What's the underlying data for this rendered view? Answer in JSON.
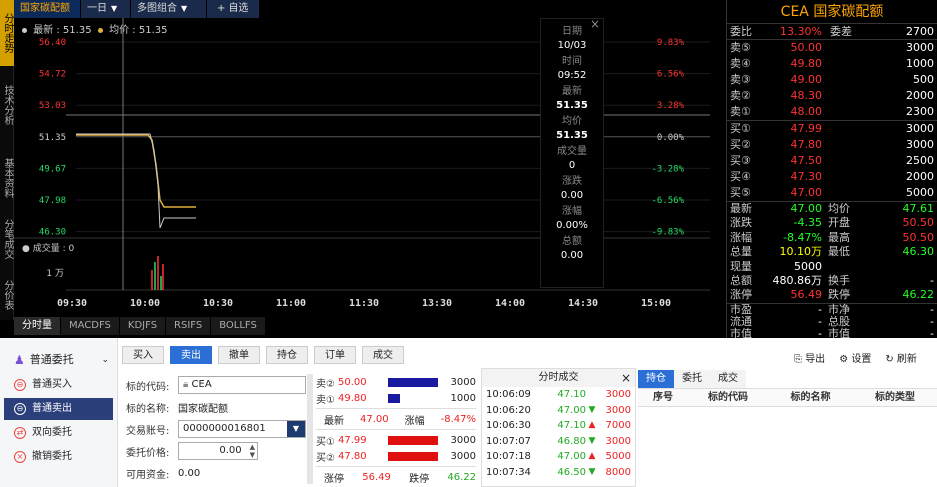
{
  "vtabs": [
    "分时走势",
    "技术分析",
    "基本资料",
    "分笔成交",
    "分价表"
  ],
  "toolbar": {
    "title": "国家碳配额",
    "period": "一日",
    "combo": "多图组合",
    "add": "+ 自选"
  },
  "legend": {
    "latest_label": "最新",
    "latest_value": "51.35",
    "avg_label": "均价",
    "avg_value": "51.35"
  },
  "chart": {
    "price_ticks": [
      "56.40",
      "54.72",
      "53.03",
      "51.35",
      "49.67",
      "47.98",
      "46.30"
    ],
    "pct_ticks": [
      "9.83%",
      "6.56%",
      "3.28%",
      "0.00%",
      "-3.28%",
      "-6.56%",
      "-9.83%"
    ],
    "time_ticks": [
      "09:30",
      "10:00",
      "10:30",
      "11:00",
      "11:30",
      "13:30",
      "14:00",
      "14:30",
      "15:00"
    ],
    "volume_label": "成交量",
    "volume_value": "0",
    "volume_tick": "1 万",
    "colors": {
      "price_line": "#e0b040",
      "avg_line": "#cccccc",
      "red": "#ff3333",
      "green": "#22dd66"
    }
  },
  "popup": {
    "date_label": "日期",
    "date": "10/03",
    "time_label": "时间",
    "time": "09:52",
    "latest_label": "最新",
    "latest": "51.35",
    "avg_label": "均价",
    "avg": "51.35",
    "vol_label": "成交量",
    "vol": "0",
    "chg_label": "涨跌",
    "chg": "0.00",
    "pct_label": "涨幅",
    "pct": "0.00%",
    "amount_label": "总额",
    "amount": "0.00",
    "close": "×"
  },
  "chart_tabs": [
    "分时量",
    "MACDFS",
    "KDJFS",
    "RSIFS",
    "BOLLFS"
  ],
  "quote": {
    "title": "CEA 国家碳配额",
    "ratio_label": "委比",
    "ratio": "13.30%",
    "diff_label": "委差",
    "diff": "2700",
    "asks": [
      {
        "k": "卖⑤",
        "p": "50.00",
        "q": "3000"
      },
      {
        "k": "卖④",
        "p": "49.80",
        "q": "1000"
      },
      {
        "k": "卖③",
        "p": "49.00",
        "q": "500"
      },
      {
        "k": "卖②",
        "p": "48.30",
        "q": "2000"
      },
      {
        "k": "卖①",
        "p": "48.00",
        "q": "2300"
      }
    ],
    "bids": [
      {
        "k": "买①",
        "p": "47.99",
        "q": "3000"
      },
      {
        "k": "买②",
        "p": "47.80",
        "q": "3000"
      },
      {
        "k": "买③",
        "p": "47.50",
        "q": "2500"
      },
      {
        "k": "买④",
        "p": "47.30",
        "q": "2000"
      },
      {
        "k": "买⑤",
        "p": "47.00",
        "q": "5000"
      }
    ],
    "stats": [
      {
        "k": "最新",
        "v": "47.00",
        "vc": "green",
        "k2": "均价",
        "v2": "47.61",
        "v2c": "green"
      },
      {
        "k": "涨跌",
        "v": "-4.35",
        "vc": "green",
        "k2": "开盘",
        "v2": "50.50",
        "v2c": "red"
      },
      {
        "k": "涨幅",
        "v": "-8.47%",
        "vc": "green",
        "k2": "最高",
        "v2": "50.50",
        "v2c": "red"
      },
      {
        "k": "总量",
        "v": "10.10万",
        "vc": "yellow",
        "k2": "最低",
        "v2": "46.30",
        "v2c": "green"
      },
      {
        "k": "现量",
        "v": "5000",
        "vc": "white",
        "k2": "",
        "v2": "",
        "v2c": "white"
      },
      {
        "k": "总额",
        "v": "480.86万",
        "vc": "white",
        "k2": "换手",
        "v2": "-",
        "v2c": "white"
      },
      {
        "k": "涨停",
        "v": "56.49",
        "vc": "red",
        "k2": "跌停",
        "v2": "46.22",
        "v2c": "green"
      }
    ],
    "mkt": [
      {
        "k": "市盈",
        "v": "-",
        "k2": "市净",
        "v2": "-"
      },
      {
        "k": "流通",
        "v": "-",
        "k2": "总股",
        "v2": "-"
      },
      {
        "k": "市值",
        "v": "-",
        "k2": "市值",
        "v2": "-"
      }
    ]
  },
  "menu": {
    "head": "普通委托",
    "items": [
      "普通买入",
      "普通卖出",
      "双向委托",
      "撤销委托"
    ]
  },
  "actions": [
    "买入",
    "卖出",
    "撤单",
    "持仓",
    "订单",
    "成交"
  ],
  "form": {
    "code_label": "标的代码:",
    "code_value": "CEA",
    "name_label": "标的名称:",
    "name_value": "国家碳配额",
    "account_label": "交易账号:",
    "account_value": "0000000016801",
    "price_label": "委托价格:",
    "price_value": "0.00",
    "funds_label": "可用资金:",
    "funds_value": "0.00"
  },
  "mini": {
    "ask2": {
      "k": "卖②",
      "p": "50.00",
      "q": "3000"
    },
    "ask1": {
      "k": "卖①",
      "p": "49.80",
      "q": "1000"
    },
    "latest_label": "最新",
    "latest": "47.00",
    "pct_label": "涨幅",
    "pct": "-8.47%",
    "bid1": {
      "k": "买①",
      "p": "47.99",
      "q": "3000"
    },
    "bid2": {
      "k": "买②",
      "p": "47.80",
      "q": "3000"
    },
    "up_label": "涨停",
    "up": "56.49",
    "down_label": "跌停",
    "down": "46.22"
  },
  "ticks": {
    "title": "分时成交",
    "close": "×",
    "rows": [
      {
        "t": "10:06:09",
        "p": "47.10",
        "a": "",
        "q": "3000",
        "c": "green"
      },
      {
        "t": "10:06:20",
        "p": "47.00",
        "a": "▼",
        "q": "3000",
        "c": "green"
      },
      {
        "t": "10:06:30",
        "p": "47.10",
        "a": "▲",
        "q": "7000",
        "c": "green"
      },
      {
        "t": "10:07:07",
        "p": "46.80",
        "a": "▼",
        "q": "3000",
        "c": "green"
      },
      {
        "t": "10:07:18",
        "p": "47.00",
        "a": "▲",
        "q": "5000",
        "c": "green"
      },
      {
        "t": "10:07:34",
        "p": "46.50",
        "a": "▼",
        "q": "8000",
        "c": "green"
      }
    ]
  },
  "top_right": {
    "export": "导出",
    "settings": "设置",
    "refresh": "刷新"
  },
  "right_tabs": [
    "持仓",
    "委托",
    "成交"
  ],
  "right_table": [
    "序号",
    "标的代码",
    "标的名称",
    "标的类型"
  ]
}
